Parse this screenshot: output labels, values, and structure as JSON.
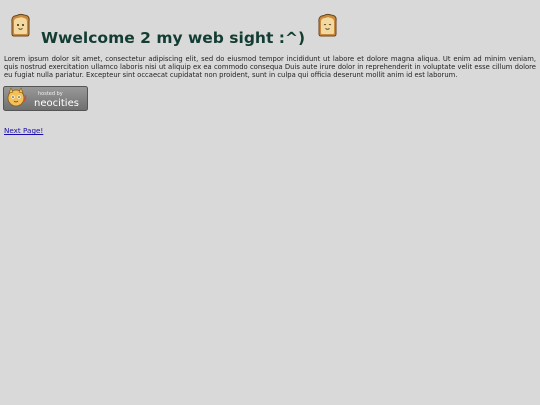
{
  "header": {
    "title": "Wwelcome 2 my web sight :^)",
    "left_icon": "bread-icon",
    "right_icon": "bread-icon"
  },
  "body_text": "Lorem ipsum dolor sit amet, consectetur adipiscing elit, sed do eiusmod tempor incididunt ut labore et dolore magna aliqua. Ut enim ad minim veniam, quis nostrud exercitation ullamco laboris nisi ut aliquip ex ea commodo consequa Duis aute irure dolor in reprehenderit in voluptate velit esse cillum dolore eu fugiat nulla pariatur. Excepteur sint occaecat cupidatat non proident, sunt in culpa qui officia deserunt mollit anim id est laborum.",
  "badge": {
    "small_text": "hosted by",
    "brand_text": "neocities",
    "icon": "neocities-cat-icon"
  },
  "next_link": "Next Page!",
  "colors": {
    "background": "#d9d9d9",
    "title": "#133d33",
    "link": "#1a0dab"
  }
}
